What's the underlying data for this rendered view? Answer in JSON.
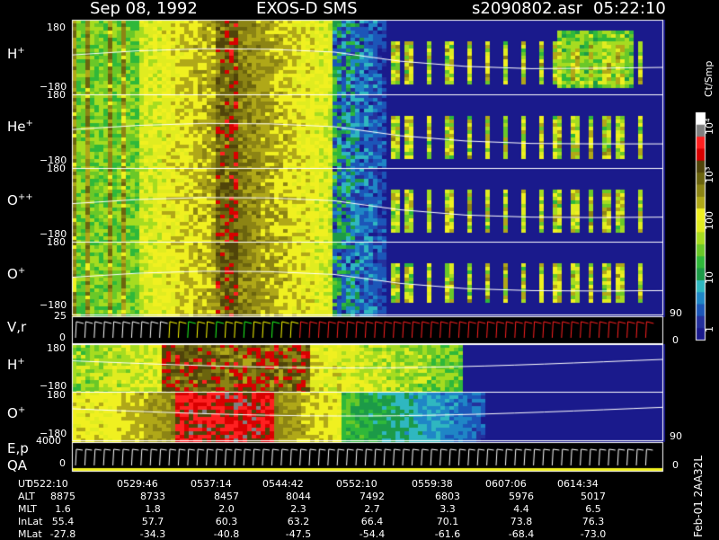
{
  "title": {
    "date": "Sep 08, 1992",
    "instrument": "EXOS-D SMS",
    "file": "s2090802.asr",
    "time": "05:22:10"
  },
  "colors": {
    "background": "#000000",
    "foreground": "#ffffff",
    "colorbar": [
      "#1a1a8c",
      "#24309c",
      "#1c56b8",
      "#1f86c6",
      "#2fb7c0",
      "#1c9a48",
      "#2fb83a",
      "#6ac828",
      "#a6dc20",
      "#e0ec20",
      "#f0f020",
      "#b0a818",
      "#8c8414",
      "#6b640e",
      "#50440a",
      "#d80000",
      "#ff2020",
      "#808080",
      "#ffffff"
    ]
  },
  "colorbar": {
    "label": "Ct/Smp",
    "ticks": [
      "10⁴",
      "10³",
      "100",
      "10",
      "1"
    ]
  },
  "right_axis": {
    "top": "90",
    "bottom": "0"
  },
  "chart_data": [
    {
      "type": "heatmap",
      "panel": "H+",
      "label": "H",
      "sup": "+",
      "ylim": [
        -180,
        180
      ],
      "yticks": [
        "180",
        "−180"
      ],
      "x_range_ut": [
        "05:22:10",
        "06:19:00"
      ],
      "white_trace": [
        10,
        30,
        40,
        38,
        24,
        -20,
        -45,
        -56,
        -54,
        -50
      ]
    },
    {
      "type": "heatmap",
      "panel": "He+",
      "label": "He",
      "sup": "+",
      "ylim": [
        -180,
        180
      ],
      "yticks": [
        "180",
        "−180"
      ],
      "white_trace": [
        8,
        28,
        38,
        36,
        22,
        -22,
        -48,
        -60,
        -62,
        -62
      ]
    },
    {
      "type": "heatmap",
      "panel": "O++",
      "label": "O",
      "sup": "++",
      "ylim": [
        -180,
        180
      ],
      "yticks": [
        "180",
        "−180"
      ],
      "white_trace": [
        6,
        26,
        36,
        34,
        20,
        -24,
        -50,
        -60,
        -62,
        -60
      ]
    },
    {
      "type": "heatmap",
      "panel": "O+",
      "label": "O",
      "sup": "+",
      "ylim": [
        -180,
        180
      ],
      "yticks": [
        "180",
        "−180"
      ],
      "white_trace": [
        4,
        24,
        34,
        32,
        18,
        -26,
        -52,
        -62,
        -64,
        -62
      ]
    },
    {
      "type": "line",
      "panel": "V,r",
      "label": "V,r",
      "yticks": [
        "25",
        "0"
      ],
      "right_ticks": [
        "90",
        "0"
      ]
    },
    {
      "type": "heatmap",
      "panel": "H+ (lower)",
      "label": "H",
      "sup": "+",
      "ylim": [
        -180,
        180
      ],
      "yticks": [
        "180",
        "−180"
      ]
    },
    {
      "type": "heatmap",
      "panel": "O+ (lower)",
      "label": "O",
      "sup": "+",
      "ylim": [
        -180,
        180
      ],
      "yticks": [
        "180",
        "−180"
      ]
    },
    {
      "type": "line",
      "panel": "E,p / QA",
      "label": "E,p",
      "label2": "QA",
      "yticks": [
        "4000",
        "0"
      ],
      "right_ticks": [
        "90",
        "0"
      ]
    }
  ],
  "orbit_table": {
    "rows": [
      {
        "name": "UT",
        "values": [
          "0522:10",
          "0529:46",
          "0537:14",
          "0544:42",
          "0552:10",
          "0559:38",
          "0607:06",
          "0614:34"
        ]
      },
      {
        "name": "ALT",
        "values": [
          "8875",
          "8733",
          "8457",
          "8044",
          "7492",
          "6803",
          "5976",
          "5017"
        ]
      },
      {
        "name": "MLT",
        "values": [
          "1.6",
          "1.8",
          "2.0",
          "2.3",
          "2.7",
          "3.3",
          "4.4",
          "6.5"
        ]
      },
      {
        "name": "InLat",
        "values": [
          "55.4",
          "57.7",
          "60.3",
          "63.2",
          "66.4",
          "70.1",
          "73.8",
          "76.3"
        ]
      },
      {
        "name": "MLat",
        "values": [
          "-27.8",
          "-34.3",
          "-40.8",
          "-47.5",
          "-54.4",
          "-61.6",
          "-68.4",
          "-73.0"
        ]
      }
    ]
  },
  "footer_code": "Feb-01 2AA32L"
}
